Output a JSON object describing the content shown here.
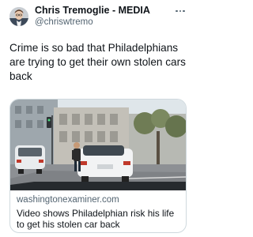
{
  "tweet": {
    "author": {
      "display_name": "Chris Tremoglie - MEDIA",
      "handle": "@chriswtremo"
    },
    "more_icon": "more-dots-icon",
    "text": "Crime is so bad that Philadelphians are trying to get their own stolen cars back"
  },
  "link_card": {
    "domain": "washingtonexaminer.com",
    "title": "Video shows Philadelphian risk his life to get his stolen car back"
  },
  "colors": {
    "text_primary": "#0f1419",
    "text_secondary": "#536471",
    "border": "#cfd9de"
  }
}
